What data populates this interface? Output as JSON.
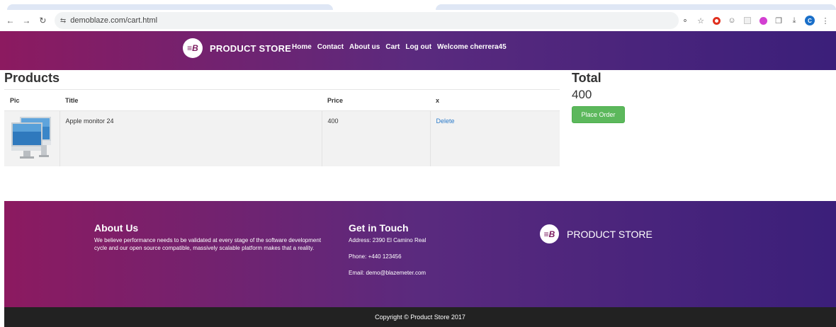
{
  "browser": {
    "url": "demoblaze.com/cart.html"
  },
  "header": {
    "brand": "PRODUCT STORE",
    "logo_text": "☰B",
    "nav": [
      "Home",
      "Contact",
      "About us",
      "Cart",
      "Log out",
      "Welcome cherrera45"
    ]
  },
  "products": {
    "title": "Products",
    "columns": [
      "Pic",
      "Title",
      "Price",
      "x"
    ],
    "rows": [
      {
        "title": "Apple monitor 24",
        "price": "400",
        "action": "Delete"
      }
    ]
  },
  "total": {
    "title": "Total",
    "value": "400",
    "button": "Place Order"
  },
  "footer": {
    "about_title": "About Us",
    "about_text": "We believe performance needs to be validated at every stage of the software development cycle and our open source compatible, massively scalable platform makes that a reality.",
    "contact_title": "Get in Touch",
    "address": "Address: 2390 El Camino Real",
    "phone": "Phone: +440 123456",
    "email": "Email: demo@blazemeter.com",
    "brand": "PRODUCT STORE",
    "copyright": "Copyright © Product Store 2017"
  },
  "colors": {
    "header_gradient_start": "#8c1a60",
    "header_gradient_end": "#3b1f7a",
    "place_order": "#5cb85c",
    "link": "#2a7ac9",
    "copyright_bg": "#222222"
  }
}
